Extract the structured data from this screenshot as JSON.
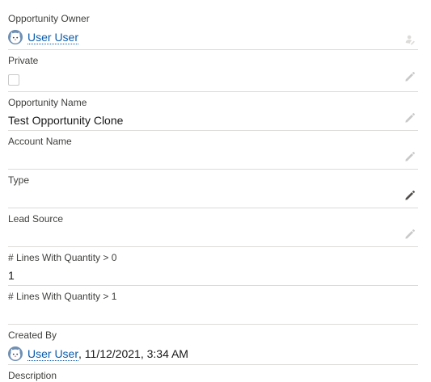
{
  "fields": {
    "owner": {
      "label": "Opportunity Owner",
      "user_name": "User User",
      "avatar_icon": "user-avatar-icon",
      "action_icon": "change-owner-icon"
    },
    "private": {
      "label": "Private",
      "checked": false,
      "edit_icon": "pencil-icon"
    },
    "opportunity_name": {
      "label": "Opportunity Name",
      "value": "Test Opportunity Clone",
      "edit_icon": "pencil-icon"
    },
    "account_name": {
      "label": "Account Name",
      "value": "",
      "edit_icon": "pencil-icon"
    },
    "type": {
      "label": "Type",
      "value": "",
      "edit_icon": "pencil-icon"
    },
    "lead_source": {
      "label": "Lead Source",
      "value": "",
      "edit_icon": "pencil-icon"
    },
    "lines_qty_gt_0": {
      "label": "# Lines With Quantity > 0",
      "value": "1"
    },
    "lines_qty_gt_1": {
      "label": "# Lines With Quantity > 1",
      "value": ""
    },
    "created_by": {
      "label": "Created By",
      "user_name": "User User",
      "timestamp": ", 11/12/2021, 3:34 AM",
      "avatar_icon": "user-avatar-icon"
    },
    "description": {
      "label": "Description"
    }
  },
  "colors": {
    "link": "#0b5cab",
    "label": "#3e3e3c",
    "value": "#181818",
    "divider": "#dddbda",
    "icon_muted": "#c9c9c9",
    "icon_active": "#706e6b"
  }
}
